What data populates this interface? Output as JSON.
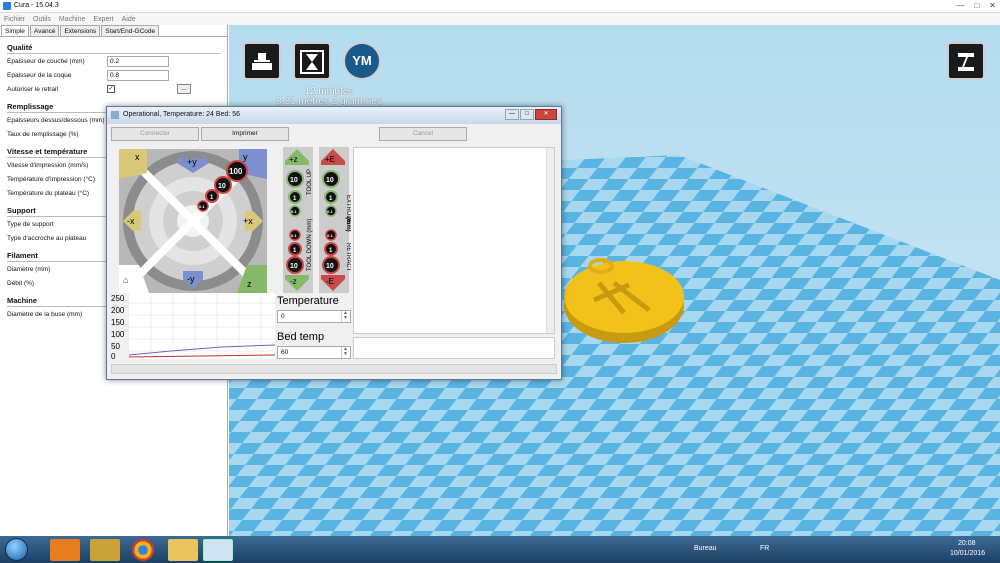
{
  "window": {
    "title": "Cura - 15.04.3",
    "menu": [
      "Fichier",
      "Outils",
      "Machine",
      "Expert",
      "Aide"
    ]
  },
  "sidebar": {
    "tabs": [
      "Simple",
      "Avancé",
      "Extensions",
      "Start/End-GCode"
    ],
    "quality": {
      "heading": "Qualité",
      "layer_height_label": "Epaisseur de couche (mm)",
      "layer_height_value": "0.2",
      "shell_label": "Epaisseur de la coque",
      "shell_value": "0.8",
      "retract_label": "Autoriser le retrait",
      "retract_checked": "✓",
      "dots_label": "..."
    },
    "fill": {
      "heading": "Remplissage",
      "topbottom_label": "Epaisseurs dessus/dessous (mm)",
      "density_label": "Taux de remplissage (%)"
    },
    "speed": {
      "heading": "Vitesse et température",
      "print_speed_label": "Vitesse d'impression (mm/s)",
      "print_temp_label": "Température d'impression (°C)",
      "bed_temp_label": "Température du plateau (°C)"
    },
    "support": {
      "heading": "Support",
      "type_label": "Type de support",
      "adhesion_label": "Type d'accroche au plateau"
    },
    "filament": {
      "heading": "Filament",
      "diameter_label": "Diamètre (mm)",
      "flow_label": "Débit (%)"
    },
    "machine": {
      "heading": "Machine",
      "nozzle_label": "Diamètre de la buse (mm)"
    }
  },
  "viewport": {
    "badge_ym": "YM",
    "print_time": "12 minutes",
    "print_material": "0.31 mètres 2 grammes"
  },
  "dialog": {
    "title": "Operational, Temperature: 24 Bed: 56",
    "connect_label": "Connecter",
    "print_label": "Imprimer",
    "cancel_label": "Cancel",
    "temperature_label": "Temperature",
    "temperature_value": "0",
    "bed_temp_label": "Bed temp",
    "bed_temp_value": "60",
    "jog": {
      "home_x": "x",
      "y_plus": "+y",
      "y_home": "y",
      "x_minus": "-x",
      "x_plus": "+x",
      "y_minus": "-y",
      "z_home": "z",
      "step_100": "100",
      "step_10": "10",
      "step_1": "1",
      "step_01": "0.1"
    },
    "zpanel": {
      "z_plus": "+z",
      "z_minus": "-z",
      "e_plus": "+E",
      "e_minus": "-E",
      "tool_up": "TOOL UP",
      "tool_down": "TOOL DOWN (mm)",
      "extrude": "EXTRUDE",
      "retract": "RETRACT",
      "mm": "(mm)",
      "s10": "10",
      "s1": "1",
      "s01": "0.1"
    },
    "plot": {
      "yticks": [
        "250",
        "200",
        "150",
        "100",
        "50",
        "0"
      ]
    }
  },
  "taskbar": {
    "bureau": "Bureau",
    "lang": "FR",
    "time": "20:08",
    "date": "10/01/2016"
  },
  "colors": {
    "floor_blue": "#5ab4e2",
    "floor_light": "#a8d8ef",
    "model_yellow": "#f2c21a",
    "arrow_green": "#86b86a",
    "arrow_red": "#c94a4a",
    "arrow_blue": "#7d8fd0"
  }
}
